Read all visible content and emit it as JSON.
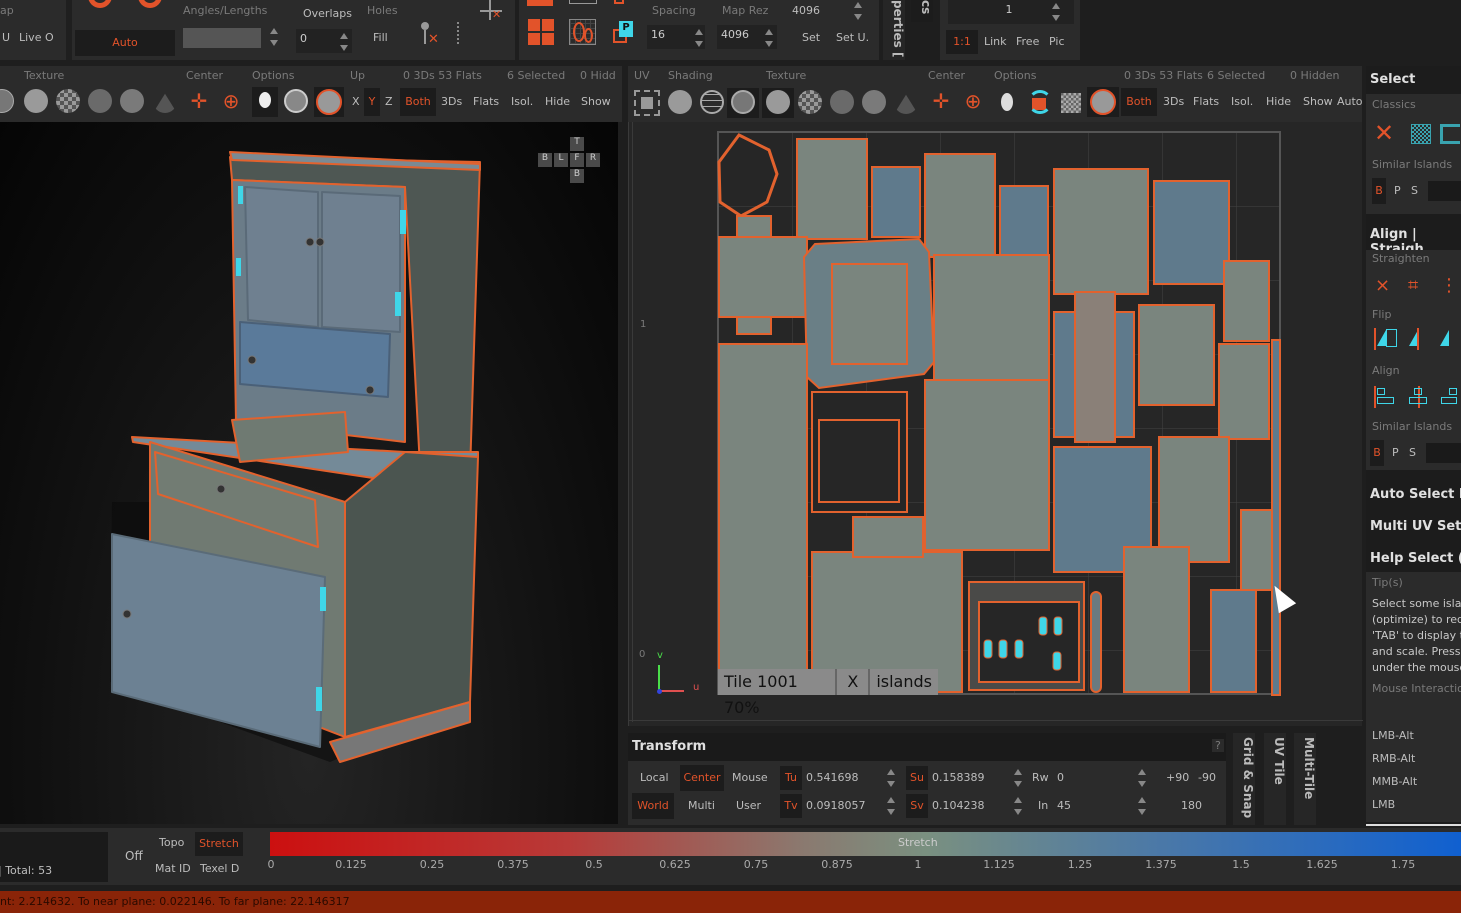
{
  "top_left": {
    "partial_label": "ap",
    "u_button": "U",
    "live_button": "Live O",
    "auto_button": "Auto",
    "angles_label": "Angles/Lengths",
    "overlaps_label": "Overlaps",
    "overlaps_value": "0",
    "holes_label": "Holes",
    "fill_button": "Fill"
  },
  "top_mid": {
    "spacing_label": "Spacing",
    "spacing_value": "16",
    "map_rez_label": "Map Rez",
    "map_rez_value_top": "4096",
    "map_rez_value": "4096",
    "set_button": "Set",
    "set_u_button": "Set U.",
    "properties_tab": "perties [",
    "cs_tab": "cs"
  },
  "top_right": {
    "value": "1",
    "ratio_button": "1:1",
    "link_button": "Link",
    "free_button": "Free",
    "pic_button": "Pic"
  },
  "viewport3d": {
    "headers": {
      "texture": "Texture",
      "center": "Center",
      "options": "Options",
      "up": "Up",
      "counts": "0 3Ds 53 Flats",
      "selected": "6 Selected",
      "hidden": "0 Hidd"
    },
    "axis": {
      "x": "X",
      "y": "Y",
      "z": "Z"
    },
    "buttons": {
      "both": "Both",
      "threeds": "3Ds",
      "flats": "Flats",
      "isol": "Isol.",
      "hide": "Hide",
      "show": "Show"
    },
    "navcube": {
      "top": "T",
      "back": "B",
      "left": "L",
      "front": "F",
      "right": "R",
      "bottom": "B"
    }
  },
  "uv_view": {
    "headers": {
      "uv": "UV",
      "shading": "Shading",
      "texture": "Texture",
      "center": "Center",
      "options": "Options",
      "counts": "0 3Ds 53 Flats",
      "selected": "6 Selected",
      "hidden": "0 Hidden"
    },
    "buttons": {
      "both": "Both",
      "threeds": "3Ds",
      "flats": "Flats",
      "isol": "Isol.",
      "hide": "Hide",
      "show": "Show",
      "auto": "Auto"
    },
    "ruler": {
      "one": "1",
      "zero": "0"
    },
    "gizmo": {
      "v": "v",
      "u": "u"
    },
    "tile_label": "Tile 1001 70%",
    "close_label": "X",
    "islands_label": "islands"
  },
  "transform": {
    "title": "Transform",
    "help": "?",
    "local": "Local",
    "center": "Center",
    "mouse": "Mouse",
    "world": "World",
    "multi": "Multi",
    "user": "User",
    "tu_label": "Tu",
    "tu_value": "0.541698",
    "tv_label": "Tv",
    "tv_value": "0.0918057",
    "su_label": "Su",
    "su_value": "0.158389",
    "sv_label": "Sv",
    "sv_value": "0.104238",
    "rw_label": "Rw",
    "rw_value": "0",
    "in_label": "In",
    "in_value": "45",
    "plus90": "+90",
    "minus90": "-90",
    "r180": "180"
  },
  "side_tabs": [
    "Grid & Snap",
    "UV Tile",
    "Multi-Tile"
  ],
  "right_panel": {
    "select_title": "Select",
    "classics_label": "Classics",
    "similar_islands_label": "Similar Islands",
    "bps": [
      "B",
      "P",
      "S"
    ],
    "align_title": "Align | Straigh",
    "straighten_label": "Straighten",
    "flip_label": "Flip",
    "align_label": "Align",
    "similar_islands_label2": "Similar Islands",
    "auto_select": "Auto Select Is",
    "multi_uv": "Multi UV Sets",
    "help_select": "Help Select (Is",
    "tips_label": "Tip(s)",
    "tips_text": [
      "Select some islan",
      "(optimize) to redu",
      "'TAB' to display tl",
      "and scale. Press k",
      "under the mouse"
    ],
    "mouse_interaction_label": "Mouse Interactio",
    "mouse_items": [
      "LMB-Alt",
      "RMB-Alt",
      "MMB-Alt",
      "LMB"
    ]
  },
  "bottom": {
    "total": "| Total: 53",
    "off": "Off",
    "topo": "Topo",
    "stretch": "Stretch",
    "mat_id": "Mat ID",
    "texel_d": "Texel D",
    "gradient_title": "Stretch",
    "ticks": [
      "0",
      "0.125",
      "0.25",
      "0.375",
      "0.5",
      "0.625",
      "0.75",
      "0.875",
      "1",
      "1.125",
      "1.25",
      "1.375",
      "1.5",
      "1.625",
      "1.75"
    ],
    "gradient_colors": {
      "low": "#cc1010",
      "mid": "#7a9080",
      "high": "#1060d0"
    }
  },
  "status": {
    "text": "nt: 2.214632. To near plane: 0.022146. To far plane: 22.146317"
  },
  "colors": {
    "accent": "#e2532a",
    "cyan": "#3fd6e8",
    "island_fill": "#7a857e",
    "island_blue": "#5a7488",
    "island_border": "#e2622e"
  }
}
